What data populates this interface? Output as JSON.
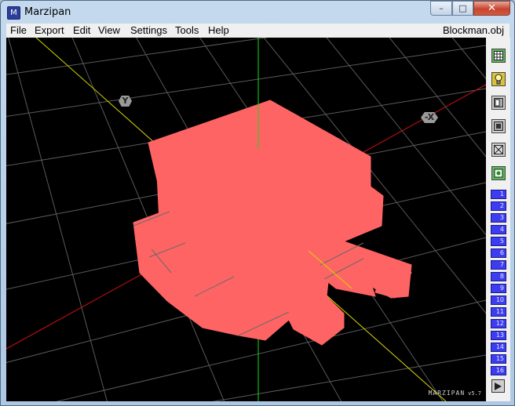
{
  "window": {
    "title": "Marzipan",
    "app_icon_glyph": "M",
    "controls": {
      "minimize": "–",
      "maximize": "□",
      "close": "✕"
    }
  },
  "menubar": {
    "items": [
      "File",
      "Export",
      "Edit",
      "View",
      "Settings",
      "Tools",
      "Help"
    ],
    "filename": "Blockman.obj"
  },
  "viewport": {
    "axis_labels": {
      "y": "Y",
      "x": "-X"
    },
    "brand": "MARZIPAN",
    "version": "v5.7",
    "colors": {
      "background": "#000000",
      "grid": "#5a5a5a",
      "model": "#ff6464",
      "x_axis": "#d01010",
      "y_axis": "#d8d800",
      "z_axis": "#18d818"
    }
  },
  "sidebar": {
    "tools": [
      "grid-icon",
      "light-icon",
      "texture-icon",
      "solid-icon",
      "wireframe-icon",
      "select-icon"
    ],
    "layers": [
      "1",
      "2",
      "3",
      "4",
      "5",
      "6",
      "7",
      "8",
      "9",
      "10",
      "11",
      "12",
      "13",
      "14",
      "15",
      "16"
    ],
    "play": "play-icon"
  }
}
